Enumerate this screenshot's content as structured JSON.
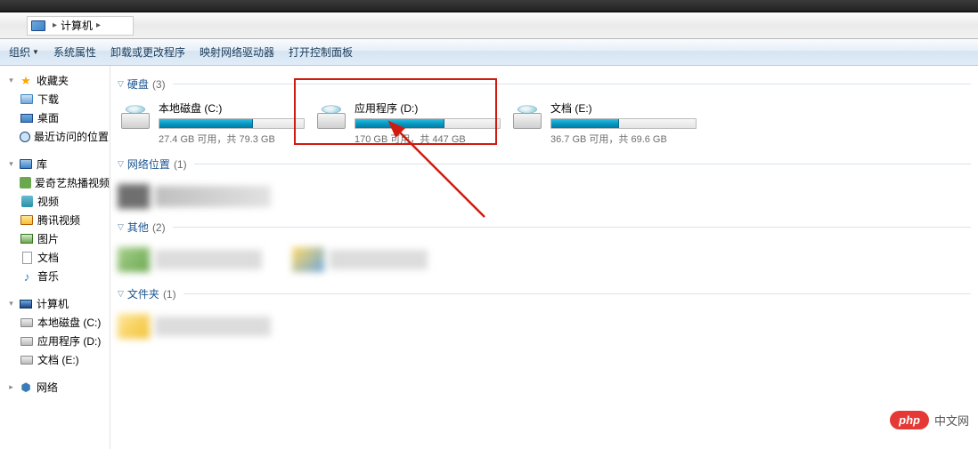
{
  "address": {
    "root": "计算机"
  },
  "toolbar": {
    "organize": "组织",
    "properties": "系统属性",
    "uninstall": "卸载或更改程序",
    "map_drive": "映射网络驱动器",
    "control_panel": "打开控制面板"
  },
  "sidebar": {
    "favorites": {
      "label": "收藏夹",
      "items": [
        "下载",
        "桌面",
        "最近访问的位置"
      ]
    },
    "libraries": {
      "label": "库",
      "items": [
        "爱奇艺热播视频",
        "视频",
        "腾讯视频",
        "图片",
        "文档",
        "音乐"
      ]
    },
    "computer": {
      "label": "计算机",
      "items": [
        "本地磁盘 (C:)",
        "应用程序 (D:)",
        "文档 (E:)"
      ]
    },
    "network": {
      "label": "网络"
    }
  },
  "groups": {
    "drives": {
      "title": "硬盘",
      "count": "(3)"
    },
    "network": {
      "title": "网络位置",
      "count": "(1)"
    },
    "other": {
      "title": "其他",
      "count": "(2)"
    },
    "folders": {
      "title": "文件夹",
      "count": "(1)"
    }
  },
  "drives": [
    {
      "name": "本地磁盘 (C:)",
      "stats": "27.4 GB 可用，共 79.3 GB",
      "used_pct": 65
    },
    {
      "name": "应用程序 (D:)",
      "stats": "170 GB 可用，共 447 GB",
      "used_pct": 62
    },
    {
      "name": "文档 (E:)",
      "stats": "36.7 GB 可用，共 69.6 GB",
      "used_pct": 47
    }
  ],
  "watermark": {
    "logo": "php",
    "text": "中文网"
  }
}
